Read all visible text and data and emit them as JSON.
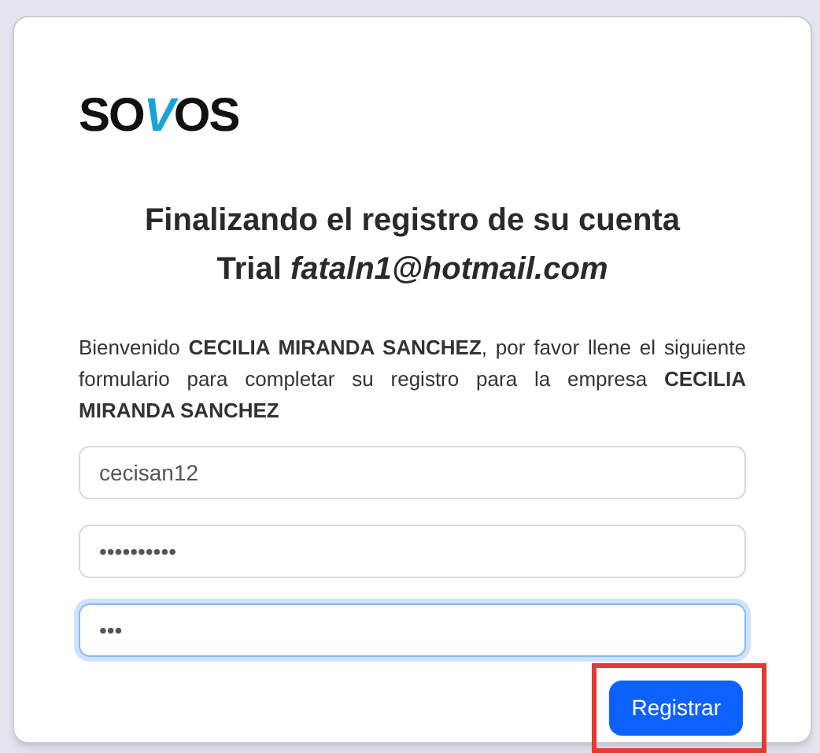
{
  "logo": "SOVOS",
  "title": {
    "line1": "Finalizando el registro de su cuenta",
    "prefix": "Trial",
    "email": "fataln1@hotmail.com"
  },
  "intro": "Bienvenido **CECILIA MIRANDA SANCHEZ**, por favor llene el siguiente formulario para completar su registro para la empresa **CECILIA MIRANDA SANCHEZ**",
  "fields": [
    {
      "value": "cecisan12",
      "focused": false
    },
    {
      "value": "••••••••••",
      "focused": false
    },
    {
      "value": "•••",
      "focused": true
    }
  ],
  "submit": {
    "label": "Registrar",
    "highlighted": true
  }
}
